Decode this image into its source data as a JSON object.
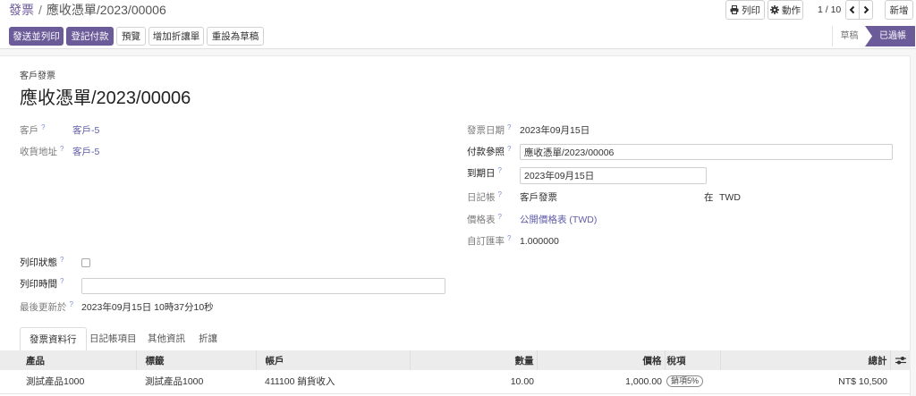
{
  "colors": {
    "primary": "#6c5b99",
    "link": "#5f5ca6",
    "label": "#7b7b7b",
    "help": "#7b8fd0",
    "table_header_bg": "#ececec"
  },
  "breadcrumb": {
    "parent": "發票",
    "separator": "/",
    "current": "應收憑單/2023/00006"
  },
  "toolbar": {
    "print": {
      "label": "列印",
      "icon": "print-icon"
    },
    "action": {
      "label": "動作",
      "icon": "gear-icon"
    },
    "pager": "1 / 10",
    "prev_icon": "chevron-left-icon",
    "next_icon": "chevron-right-icon",
    "new_label": "新增"
  },
  "action_buttons": [
    {
      "label": "發送並列印",
      "primary": true
    },
    {
      "label": "登記付款",
      "primary": true
    },
    {
      "label": "預覽",
      "primary": false
    },
    {
      "label": "增加折讓單",
      "primary": false
    },
    {
      "label": "重設為草稿",
      "primary": false
    }
  ],
  "status_bar": {
    "steps": [
      "草稿",
      "已過帳"
    ],
    "current": "已過帳"
  },
  "help_marker": "?",
  "form": {
    "move_type_label": "客戶發票",
    "name": "應收憑單/2023/00006",
    "customer": {
      "label": "客戶",
      "value": "客戶-5"
    },
    "delivery_address": {
      "label": "收貨地址",
      "value": "客戶-5"
    },
    "invoice_date": {
      "label": "發票日期",
      "value": "2023年09月15日"
    },
    "payment_reference": {
      "label": "付款參照",
      "value": "應收憑單/2023/00006"
    },
    "due_date": {
      "label": "到期日",
      "value": "2023年09月15日"
    },
    "journal": {
      "label": "日記帳",
      "value": "客戶發票",
      "in_word": "在",
      "currency": "TWD"
    },
    "pricelist": {
      "label": "價格表",
      "value": "公開價格表 (TWD)"
    },
    "custom_rate": {
      "label": "自訂匯率",
      "value": "1.000000"
    },
    "print_status": {
      "label": "列印狀態",
      "checked": false
    },
    "print_time": {
      "label": "列印時間",
      "value": ""
    },
    "last_updated": {
      "label": "最後更新於",
      "value": "2023年09月15日 10時37分10秒"
    }
  },
  "tabs": {
    "items": [
      "發票資料行",
      "日記帳項目",
      "其他資訊",
      "折讓"
    ],
    "active": "發票資料行"
  },
  "invoice_lines": {
    "columns": [
      "產品",
      "標籤",
      "帳戶",
      "數量",
      "價格",
      "稅項",
      "總計"
    ],
    "options_icon": "sliders-icon",
    "rows": [
      {
        "product": "測試產品1000",
        "label": "測試產品1000",
        "account": "411100 銷貨收入",
        "quantity": "10.00",
        "price": "1,000.00",
        "taxes": [
          "銷項5%"
        ],
        "total": "NT$ 10,500"
      }
    ]
  }
}
